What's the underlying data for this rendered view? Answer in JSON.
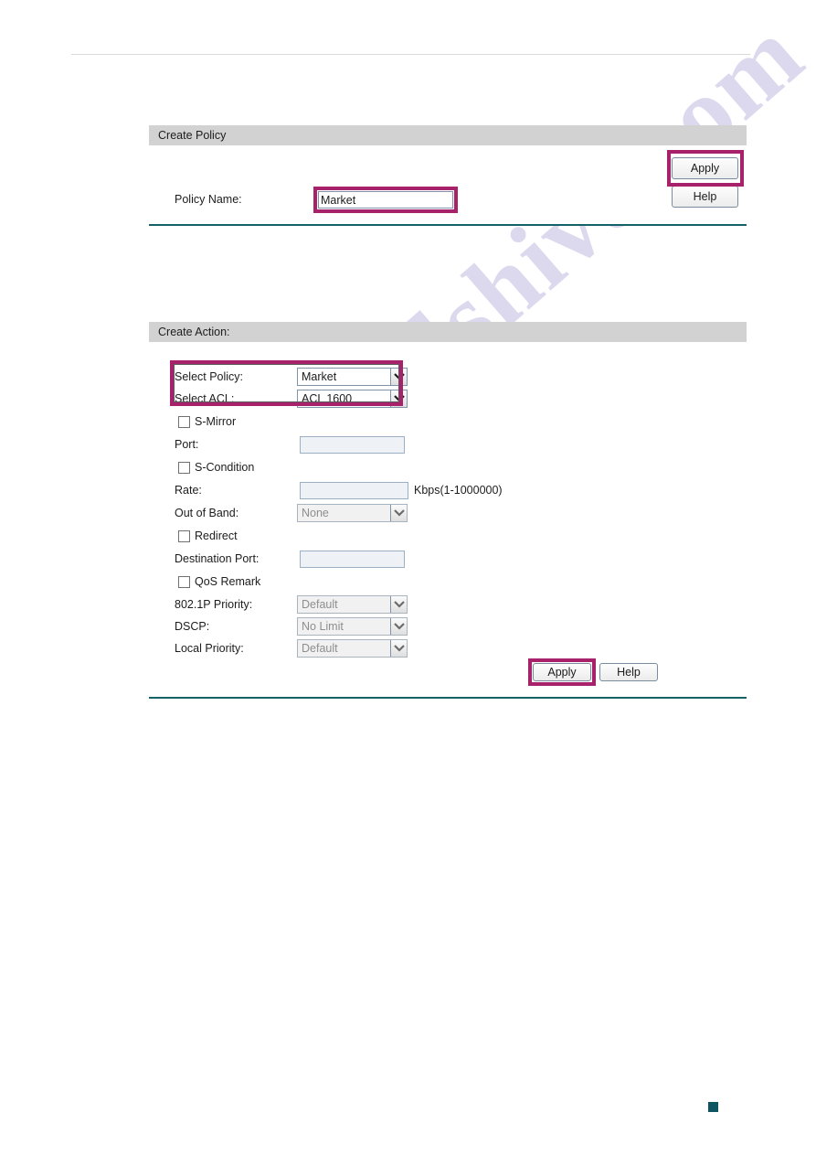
{
  "policy_panel": {
    "header": "Create Policy",
    "name_label": "Policy Name:",
    "name_value": "Market",
    "name_placeholder": "",
    "apply_label": "Apply",
    "help_label": "Help"
  },
  "action_panel": {
    "header": "Create Action:",
    "select_policy": {
      "label": "Select Policy:",
      "value": "Market"
    },
    "select_acl": {
      "label": "Select ACL:",
      "value": "ACL 1600"
    },
    "s_mirror": {
      "label": "S-Mirror",
      "checked": false
    },
    "port": {
      "label": "Port:",
      "value": "",
      "placeholder": ""
    },
    "s_condition": {
      "label": "S-Condition",
      "checked": false
    },
    "rate": {
      "label": "Rate:",
      "value": "",
      "placeholder": "",
      "unit": "Kbps(1-1000000)"
    },
    "out_of_band": {
      "label": "Out of Band:",
      "value": "None"
    },
    "redirect": {
      "label": "Redirect",
      "checked": false
    },
    "destination_port": {
      "label": "Destination Port:",
      "value": "",
      "placeholder": ""
    },
    "qos_remark": {
      "label": "QoS Remark",
      "checked": false
    },
    "priority_8021p": {
      "label": "802.1P Priority:",
      "value": "Default"
    },
    "dscp": {
      "label": "DSCP:",
      "value": "No Limit"
    },
    "local_priority": {
      "label": "Local Priority:",
      "value": "Default"
    },
    "apply_label": "Apply",
    "help_label": "Help"
  },
  "watermark": {
    "text": "manualshive.com"
  },
  "colors": {
    "highlight": "#a8216b",
    "divider": "#156168",
    "panel_header_bg": "#d2d2d2",
    "marker": "#0d5560"
  }
}
